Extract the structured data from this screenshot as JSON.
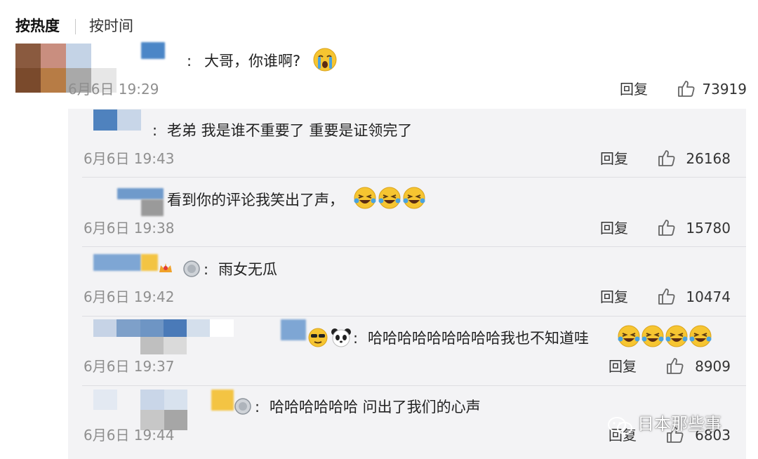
{
  "sort": {
    "hot_label": "按热度",
    "time_label": "按时间"
  },
  "main_comment": {
    "text": "大哥，你谁啊?",
    "time": "6月6日 19:29",
    "reply_label": "回复",
    "likes": "73919",
    "emoji": "crying-face"
  },
  "replies": [
    {
      "text": "老弟 我是谁不重要了 重要是证领完了",
      "time": "6月6日 19:43",
      "reply_label": "回复",
      "likes": "26168"
    },
    {
      "text": "看到你的评论我笑出了声，",
      "time": "6月6日 19:38",
      "reply_label": "回复",
      "likes": "15780",
      "emojis": [
        "laugh-cry",
        "laugh-cry",
        "laugh-cry"
      ]
    },
    {
      "text": "雨女无瓜",
      "time": "6月6日 19:42",
      "reply_label": "回复",
      "likes": "10474"
    },
    {
      "text": "哈哈哈哈哈哈哈哈哈我也不知道哇",
      "time": "6月6日 19:37",
      "reply_label": "回复",
      "likes": "8909",
      "emojis": [
        "laugh-cry",
        "laugh-cry",
        "laugh-cry",
        "laugh-cry"
      ]
    },
    {
      "text": "哈哈哈哈哈哈 问出了我们的心声",
      "time": "6月6日 19:44",
      "reply_label": "回复",
      "likes": "6803"
    }
  ],
  "watermark": {
    "text": "日本那些事"
  },
  "colors": {
    "panel_bg": "#f3f3f5",
    "time_gray": "#8f8f8f",
    "emoji_yellow": "#f6c531",
    "tear_blue": "#4aa3df"
  }
}
